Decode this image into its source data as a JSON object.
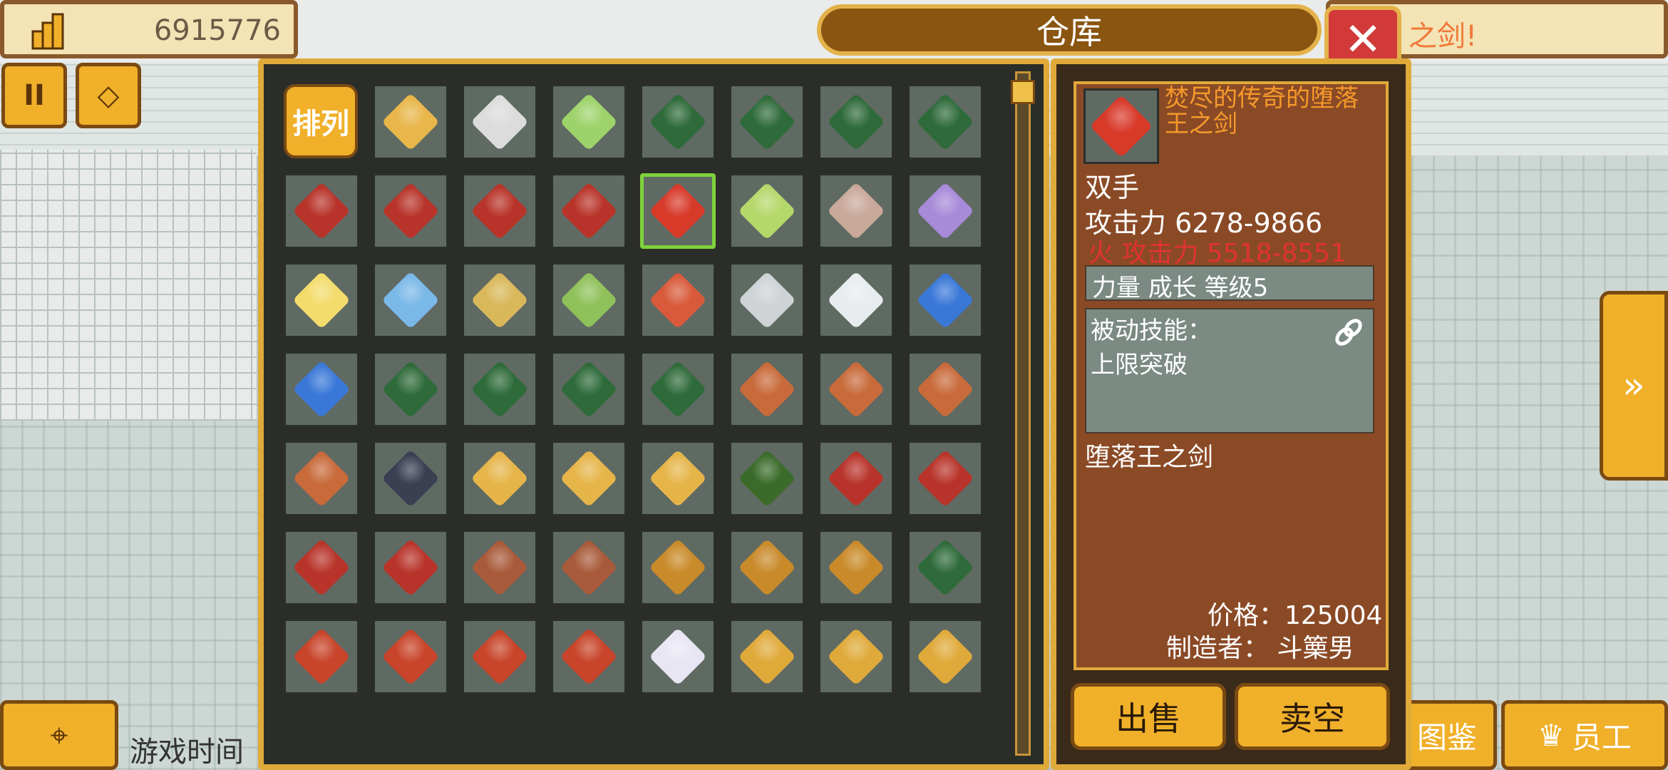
{
  "hud": {
    "gold_value": "6915776",
    "pause_label": "II",
    "gems_label": "◇",
    "banner_text": "之剑!",
    "game_time_label": "游戏时间",
    "move_icon": "⌖",
    "encyclopedia_label": "图鉴",
    "staff_label": "员工",
    "next_arrow": "»"
  },
  "warehouse": {
    "title": "仓库",
    "close_glyph": "✕",
    "sort_label": "排列",
    "items": [
      {
        "icon": "golden-sword-icon",
        "color": "#e8b64a"
      },
      {
        "icon": "silver-sword-icon",
        "color": "#dcdcdc"
      },
      {
        "icon": "green-staff-sword-icon",
        "color": "#9ed36b"
      },
      {
        "icon": "green-sword-icon",
        "color": "#2f6b3a"
      },
      {
        "icon": "green-sword-icon",
        "color": "#2f6b3a"
      },
      {
        "icon": "green-sword-icon",
        "color": "#2f6b3a"
      },
      {
        "icon": "green-sword-icon",
        "color": "#2f6b3a"
      },
      {
        "icon": "red-sword-icon",
        "color": "#b8342a"
      },
      {
        "icon": "red-sword-icon",
        "color": "#b8342a"
      },
      {
        "icon": "red-sword-icon",
        "color": "#b8342a"
      },
      {
        "icon": "red-sword-icon",
        "color": "#b8342a"
      },
      {
        "icon": "red-sword-icon",
        "color": "#d83a2a",
        "selected": true
      },
      {
        "icon": "green-spear-icon",
        "color": "#b5d86b"
      },
      {
        "icon": "skull-staff-icon",
        "color": "#c9a99a"
      },
      {
        "icon": "purple-staff-icon",
        "color": "#a78ad8"
      },
      {
        "icon": "star-wand-icon",
        "color": "#f3dc6b"
      },
      {
        "icon": "sun-wand-icon",
        "color": "#7ab8e8"
      },
      {
        "icon": "gold-hammer-icon",
        "color": "#d9b85a"
      },
      {
        "icon": "green-axe-icon",
        "color": "#8fc15a"
      },
      {
        "icon": "red-pickaxe-icon",
        "color": "#d85a3a"
      },
      {
        "icon": "silver-round-shield-icon",
        "color": "#cfd3d6"
      },
      {
        "icon": "white-round-shield-icon",
        "color": "#e9ecef"
      },
      {
        "icon": "blue-crest-shield-icon",
        "color": "#3a78d8"
      },
      {
        "icon": "blue-crest-shield-icon",
        "color": "#3a78d8"
      },
      {
        "icon": "green-shield-icon",
        "color": "#2f6b3a"
      },
      {
        "icon": "green-shield-icon",
        "color": "#2f6b3a"
      },
      {
        "icon": "green-shield-icon",
        "color": "#2f6b3a"
      },
      {
        "icon": "green-shield-icon",
        "color": "#2f6b3a"
      },
      {
        "icon": "bronze-shield-icon",
        "color": "#c86a3a"
      },
      {
        "icon": "bronze-shield-icon",
        "color": "#c86a3a"
      },
      {
        "icon": "bronze-shield-icon",
        "color": "#c86a3a"
      },
      {
        "icon": "bronze-shield-icon",
        "color": "#c86a3a"
      },
      {
        "icon": "dark-hood-icon",
        "color": "#3a3f52"
      },
      {
        "icon": "gold-crown-icon",
        "color": "#e6b54a"
      },
      {
        "icon": "gold-crown-icon",
        "color": "#e6b54a"
      },
      {
        "icon": "gold-crown-icon",
        "color": "#e6b54a"
      },
      {
        "icon": "green-gold-armor-icon",
        "color": "#3a6b2a"
      },
      {
        "icon": "red-helmet-icon",
        "color": "#b8342a"
      },
      {
        "icon": "red-helmet-icon",
        "color": "#b8342a"
      },
      {
        "icon": "red-helmet-icon",
        "color": "#b8342a"
      },
      {
        "icon": "red-helmet-icon",
        "color": "#b8342a"
      },
      {
        "icon": "brown-cloak-icon",
        "color": "#a85a3a"
      },
      {
        "icon": "brown-cloak-icon",
        "color": "#a85a3a"
      },
      {
        "icon": "gold-armor-icon",
        "color": "#c98a2a"
      },
      {
        "icon": "gold-armor-icon",
        "color": "#c98a2a"
      },
      {
        "icon": "gold-armor-icon",
        "color": "#c98a2a"
      },
      {
        "icon": "green-armor-icon",
        "color": "#2f6b3a"
      },
      {
        "icon": "red-armor-icon",
        "color": "#c8442a"
      },
      {
        "icon": "red-armor-icon",
        "color": "#c8442a"
      },
      {
        "icon": "red-armor-icon",
        "color": "#c8442a"
      },
      {
        "icon": "red-armor-icon",
        "color": "#c8442a"
      },
      {
        "icon": "purple-eye-orb-icon",
        "color": "#e9e6f3"
      },
      {
        "icon": "ruby-ring-icon",
        "color": "#e0aa3a"
      },
      {
        "icon": "ruby-ring-icon",
        "color": "#e0aa3a"
      },
      {
        "icon": "ruby-ring-icon",
        "color": "#e0aa3a"
      },
      {
        "icon": "ruby-ring-icon",
        "color": "#e0aa3a"
      },
      {
        "icon": "blue-necklace-icon",
        "color": "#8fb0d8"
      },
      {
        "icon": "gem-bracelet-icon",
        "color": "#e9d2c0"
      },
      {
        "icon": "bone-boomerang-icon",
        "color": "#b9bdb0"
      },
      {
        "icon": "white-boot-icon",
        "color": "#e4dcd2"
      },
      {
        "icon": "white-boot-icon",
        "color": "#e4dcd2"
      },
      {
        "icon": "white-boot-icon",
        "color": "#e4dcd2"
      },
      {
        "icon": "white-boot-icon",
        "color": "#e4dcd2"
      }
    ]
  },
  "detail": {
    "item_name": "焚尽的传奇的堕落王之剑",
    "hand_type": "双手",
    "attack": "攻击力 6278-9866",
    "fire_attack": "火 攻击力 5518-8551",
    "stat_line": "力量 成长 等级5",
    "passive_title": "被动技能：",
    "passive_skill": "上限突破",
    "base_name": "堕落王之剑",
    "price": "价格：125004",
    "maker": "制造者： 斗篥男",
    "sell_label": "出售",
    "sell_all_label": "卖空",
    "thumb_color": "#d83a2a"
  }
}
